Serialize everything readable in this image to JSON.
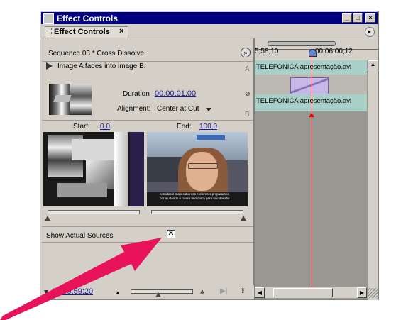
{
  "window": {
    "title": "Effect Controls",
    "buttons": [
      "_",
      "□",
      "×"
    ]
  },
  "tab": {
    "label": "Effect Controls",
    "close": "×"
  },
  "header": {
    "sequence_label": "Sequence 03 * Cross Dissolve",
    "zoom_glyph": "»"
  },
  "effect": {
    "description": "Image A fades into image B.",
    "duration_label": "Duration",
    "duration_value": "00;00;01;00",
    "alignment_label": "Alignment:",
    "alignment_value": "Center at Cut",
    "track_a": "A",
    "track_b": "B"
  },
  "preview": {
    "start_label": "Start:",
    "start_value": "0,0",
    "end_label": "End:",
    "end_value": "100,0",
    "start_progress": 0.0,
    "end_progress": 1.0,
    "subtitle_line1": "comidas é mais saborosa e oferecer proparamos",
    "subtitle_line2": "por ajudando o nosso telefonica para seu desafio"
  },
  "options": {
    "show_actual_sources_label": "Show Actual Sources",
    "show_actual_sources_checked": true
  },
  "timeline": {
    "time_left": "5;58;10",
    "time_right": "00;06;00;12",
    "clip_a": "TELEFONICA apresentação.avi",
    "clip_b": "TELEFONICA apresentação.avi"
  },
  "footer": {
    "timecode": "00;05;59;20",
    "zoom_level": 0.42
  },
  "colors": {
    "title_bg": "#000080",
    "timecode_blue": "#1a1aa0",
    "playhead": "#e00000",
    "arrow": "#e8135a",
    "track_teal": "#a8d0c8",
    "transition": "#c8b8e8"
  }
}
